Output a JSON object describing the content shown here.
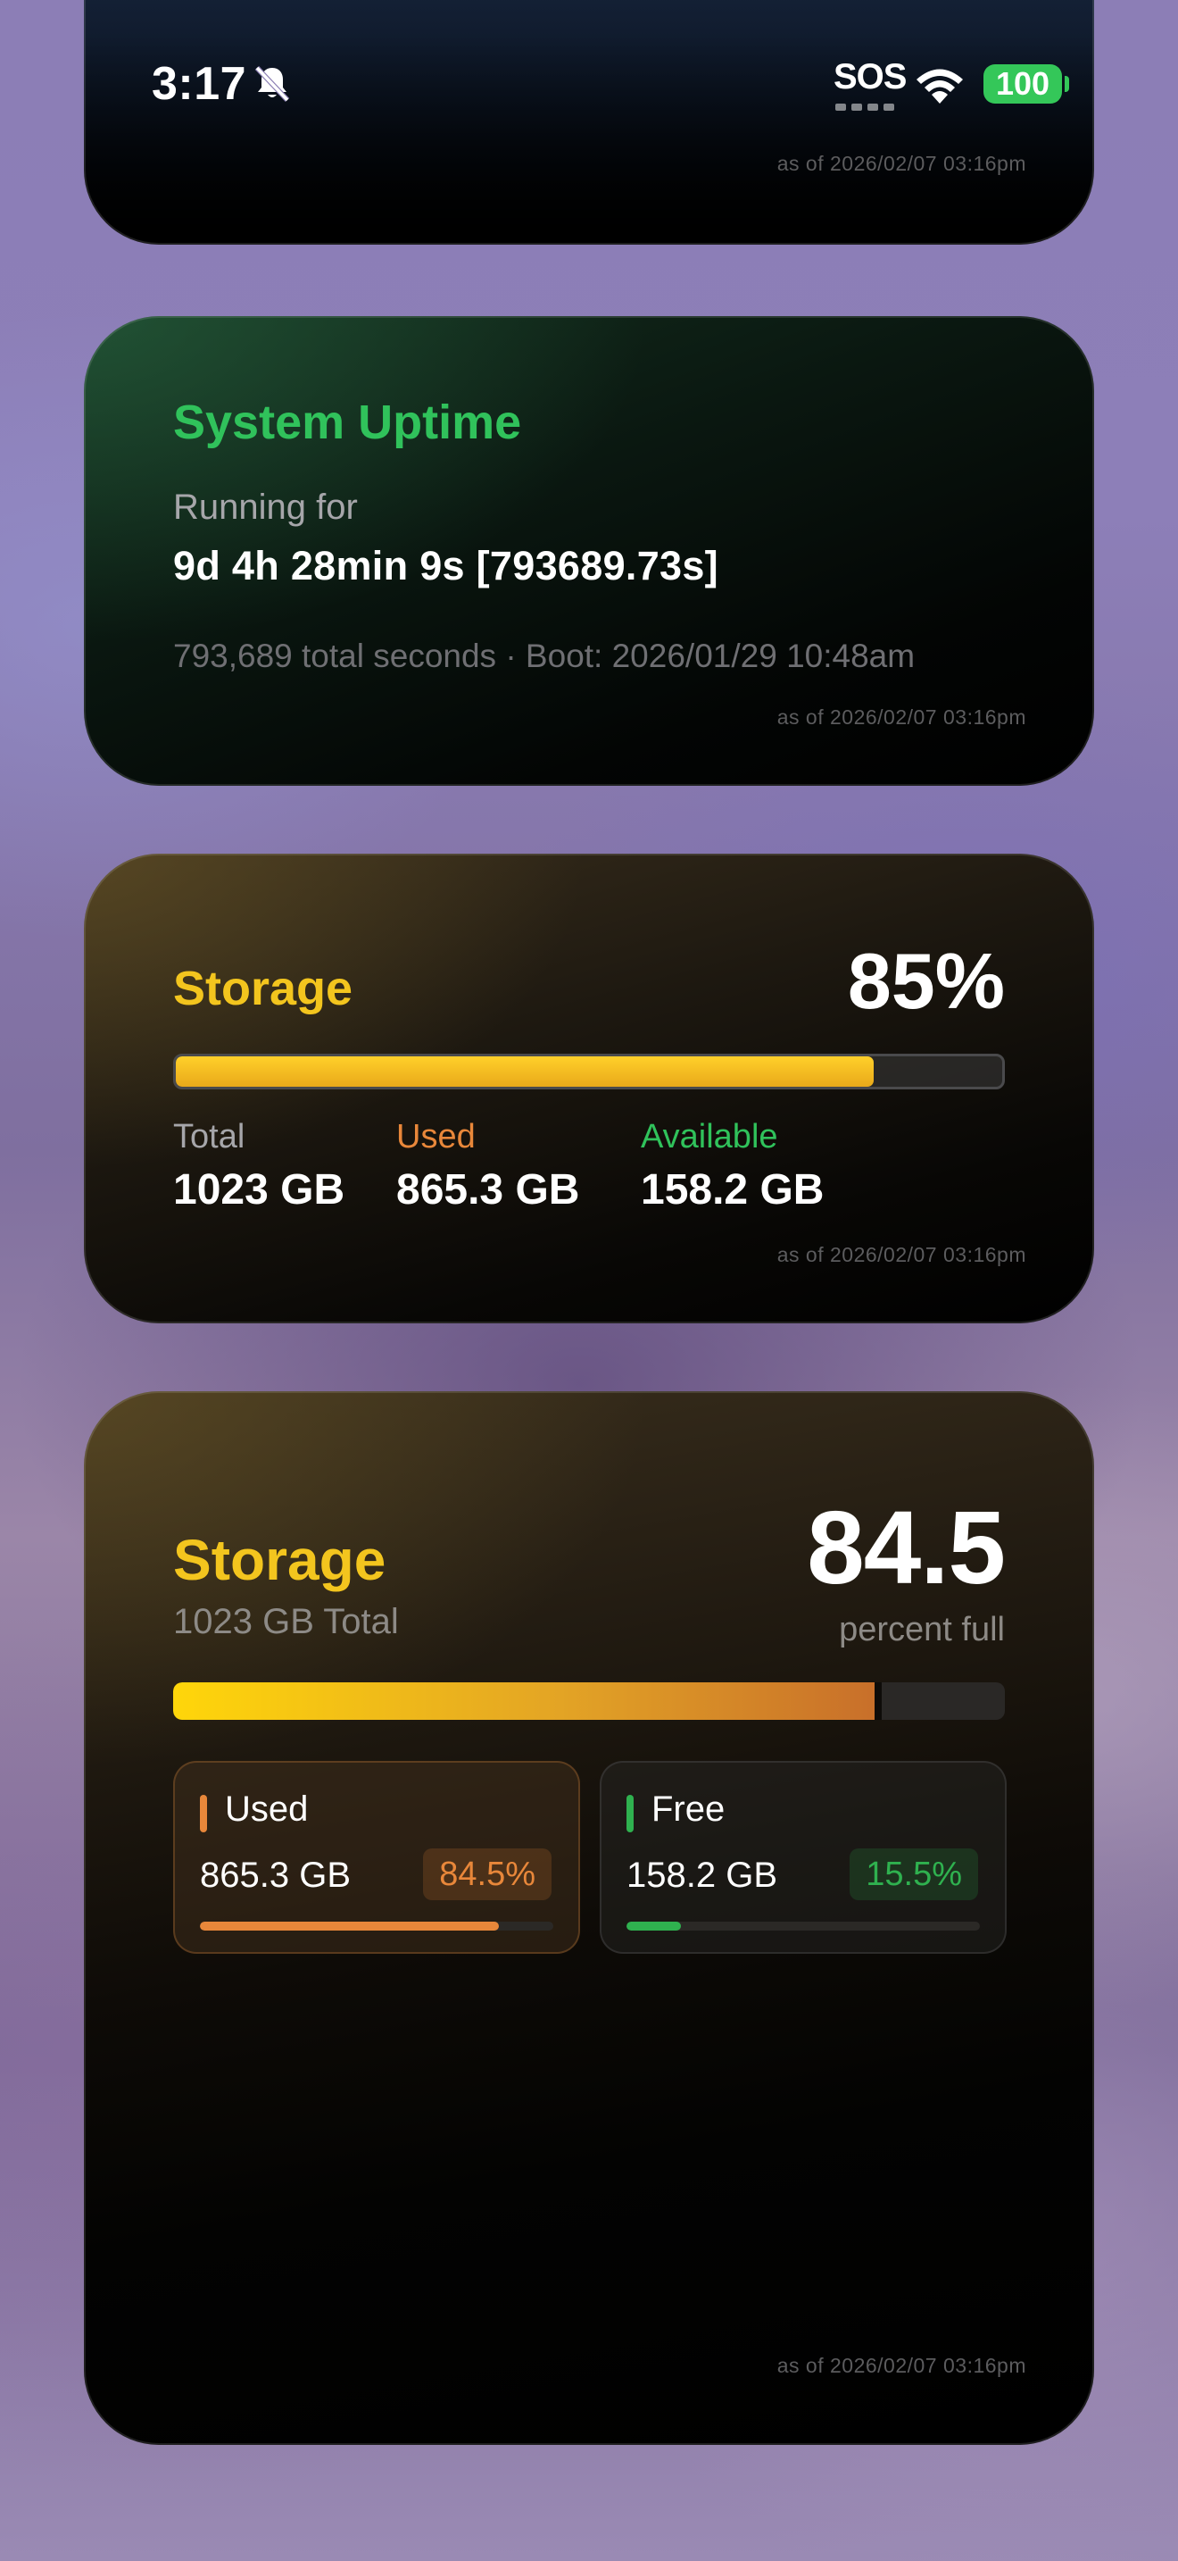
{
  "status_bar": {
    "time": "3:17",
    "sos_label": "SOS",
    "battery_level": "100"
  },
  "widgets": {
    "top_card": {
      "as_of": "as of 2026/02/07 03:16pm"
    },
    "uptime": {
      "title": "System Uptime",
      "running_label": "Running for",
      "running_value": "9d 4h 28min 9s [793689.73s]",
      "detail": "793,689 total seconds · Boot: 2026/01/29 10:48am",
      "as_of": "as of 2026/02/07 03:16pm",
      "accent_color": "#30c25b"
    },
    "storage_simple": {
      "title": "Storage",
      "percent": "85%",
      "fill_fraction": 0.845,
      "stats": [
        {
          "label": "Total",
          "value": "1023 GB",
          "color": "#a6a6aa"
        },
        {
          "label": "Used",
          "value": "865.3 GB",
          "color": "#e8873a"
        },
        {
          "label": "Available",
          "value": "158.2 GB",
          "color": "#30c25b"
        }
      ],
      "as_of": "as of 2026/02/07 03:16pm",
      "accent_color": "#f3c51e"
    },
    "storage_detailed": {
      "title": "Storage",
      "subtitle": "1023 GB Total",
      "percent_number": "84.5",
      "percent_label": "percent full",
      "fill_fraction": 0.845,
      "used": {
        "label": "Used",
        "value": "865.3 GB",
        "badge": "84.5%",
        "fraction": 0.845,
        "color": "#e8873a"
      },
      "free": {
        "label": "Free",
        "value": "158.2 GB",
        "badge": "15.5%",
        "fraction": 0.155,
        "color": "#2fb14f"
      },
      "as_of": "as of 2026/02/07 03:16pm"
    }
  }
}
